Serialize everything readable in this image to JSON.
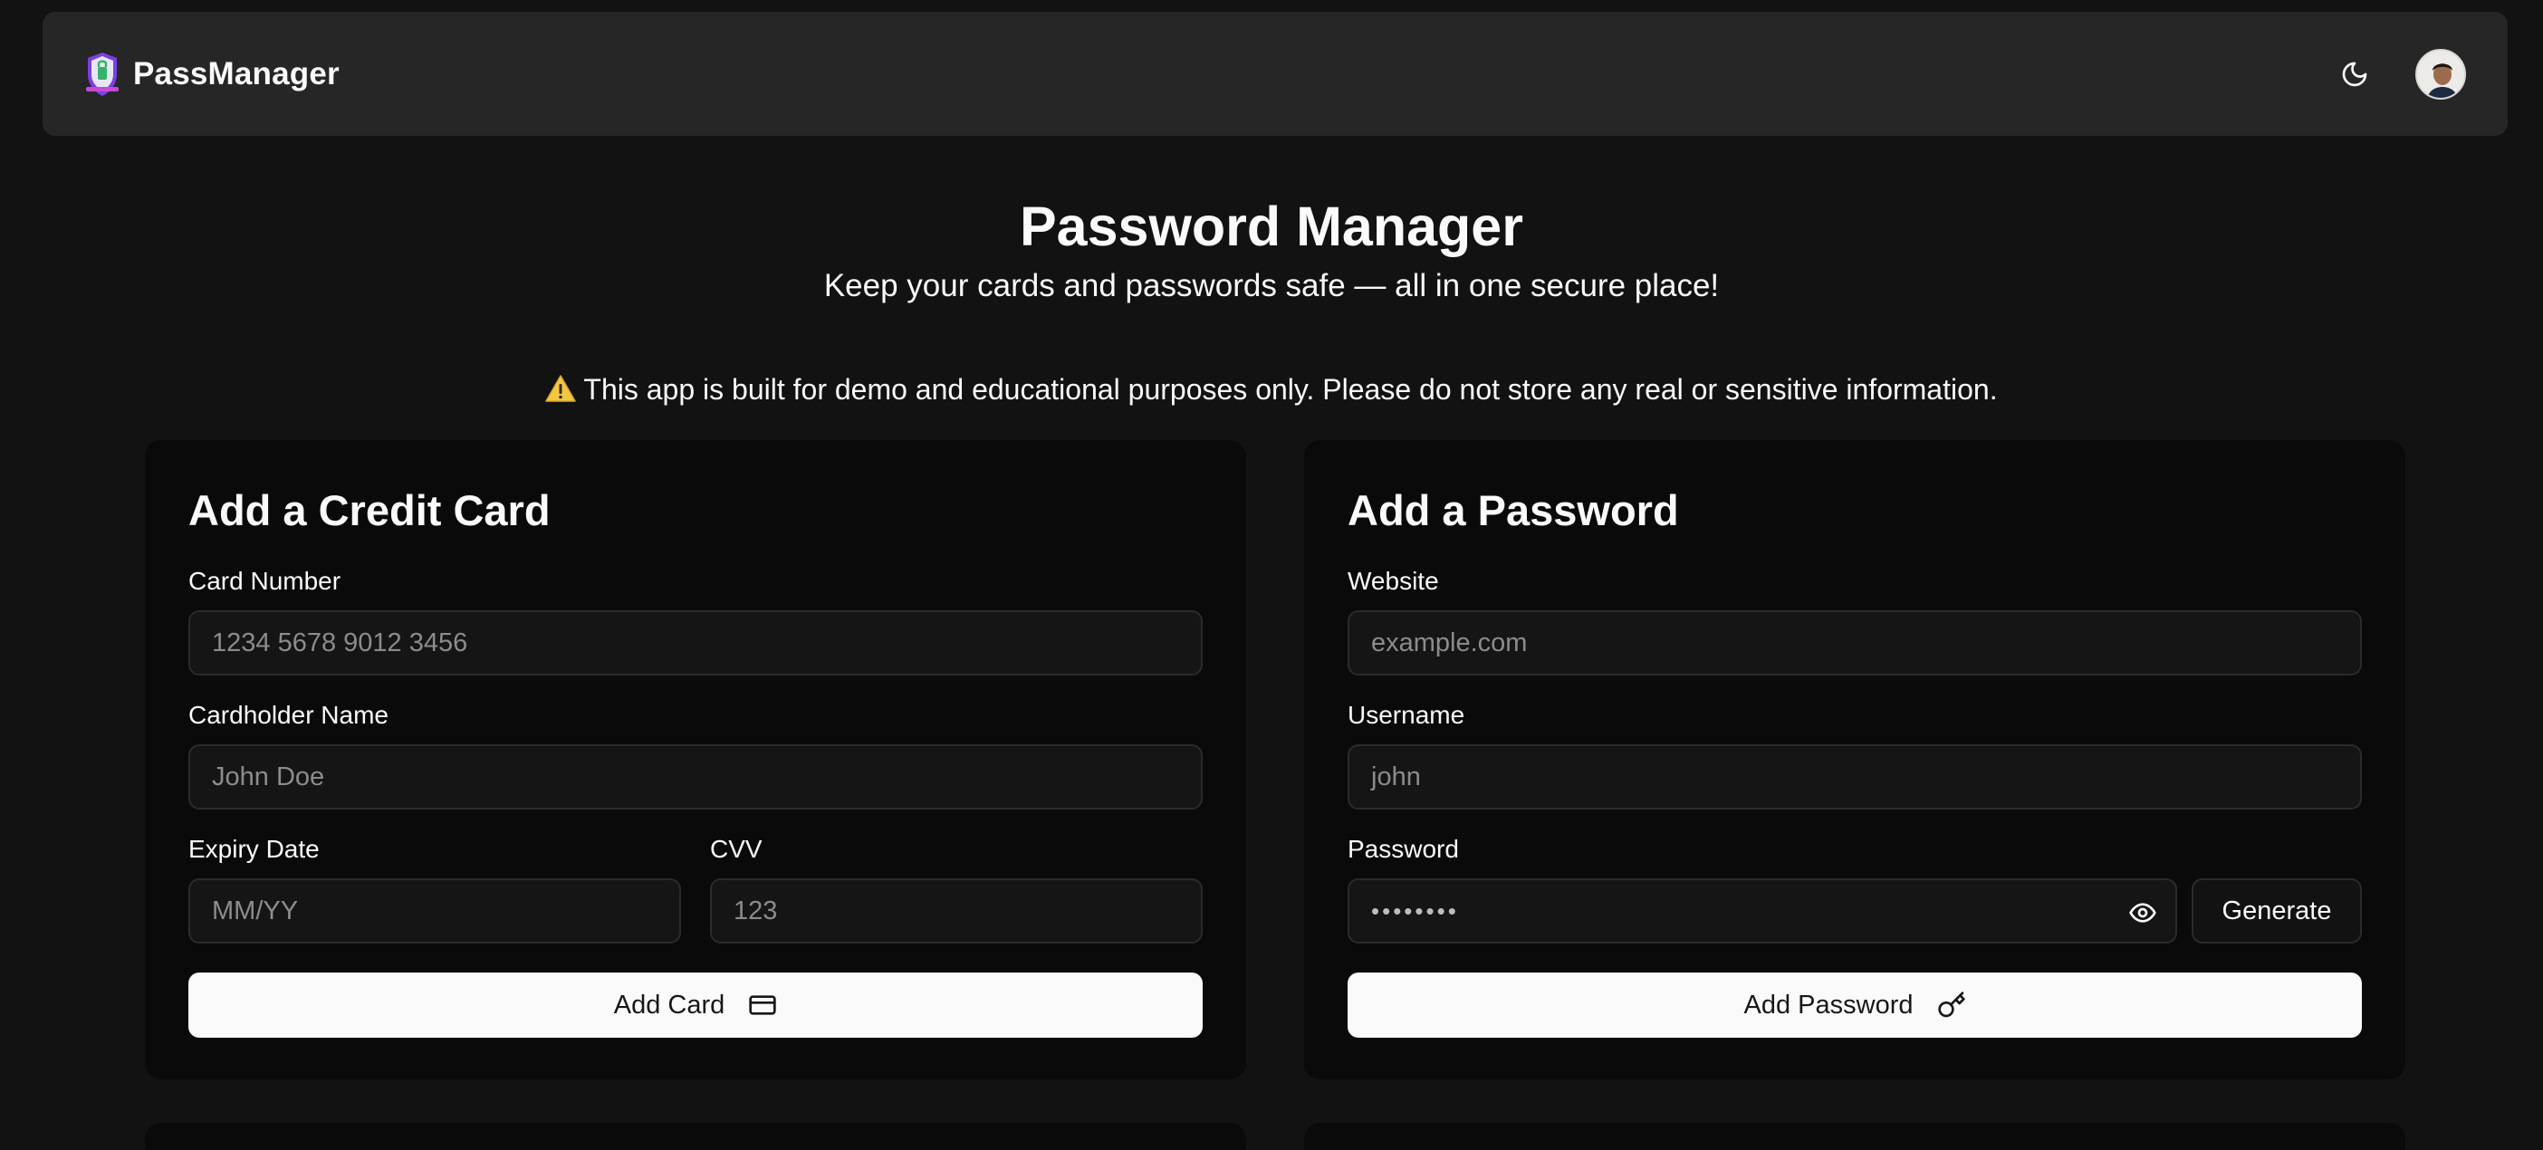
{
  "app": {
    "brand": "PassManager"
  },
  "header": {
    "theme_toggle": "moon-icon",
    "avatar": "user-avatar"
  },
  "hero": {
    "title": "Password Manager",
    "subtitle": "Keep your cards and passwords safe — all in one secure place!"
  },
  "notice": {
    "icon": "warning-icon",
    "text": "This app is built for demo and educational purposes only. Please do not store any real or sensitive information."
  },
  "credit_card_form": {
    "title": "Add a Credit Card",
    "card_number": {
      "label": "Card Number",
      "placeholder": "1234 5678 9012 3456",
      "value": ""
    },
    "cardholder_name": {
      "label": "Cardholder Name",
      "placeholder": "John Doe",
      "value": ""
    },
    "expiry_date": {
      "label": "Expiry Date",
      "placeholder": "MM/YY",
      "value": ""
    },
    "cvv": {
      "label": "CVV",
      "placeholder": "123",
      "value": ""
    },
    "submit_label": "Add Card",
    "submit_icon": "credit-card-icon"
  },
  "password_form": {
    "title": "Add a Password",
    "website": {
      "label": "Website",
      "placeholder": "example.com",
      "value": ""
    },
    "username": {
      "label": "Username",
      "placeholder": "john",
      "value": ""
    },
    "password": {
      "label": "Password",
      "placeholder": "••••••••",
      "value": ""
    },
    "toggle_visibility_icon": "eye-icon",
    "generate_label": "Generate",
    "submit_label": "Add Password",
    "submit_icon": "key-icon"
  },
  "colors": {
    "background": "#121212",
    "navbar": "#262626",
    "card": "#0a0a0a",
    "input_border": "#2b2b2b",
    "primary_button": "#fafafa",
    "warning": "#f2c744"
  }
}
